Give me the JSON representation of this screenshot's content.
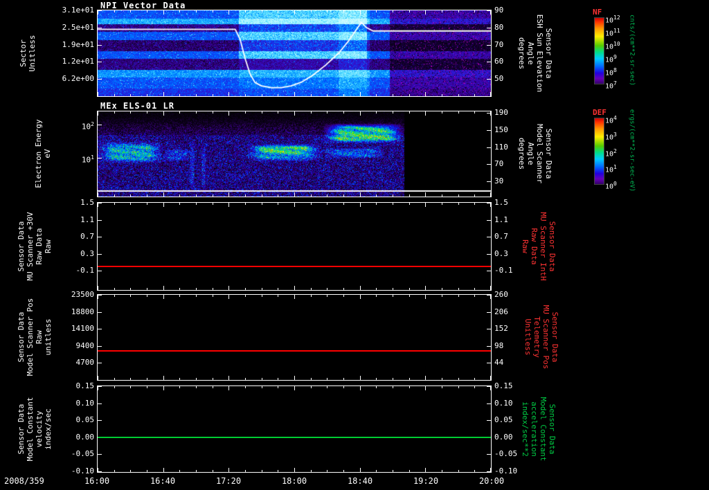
{
  "figure": {
    "date_label": "2008/359",
    "x_tick_labels": [
      "16:00",
      "16:40",
      "17:20",
      "18:00",
      "18:40",
      "19:20",
      "20:00"
    ],
    "colors": {
      "background": "#000000",
      "axis": "#ffffff",
      "red_series": "#ff0000",
      "green_series": "#00cc33",
      "red_label": "#ff3333",
      "green_label": "#00cc44",
      "units_green": "#00bb55"
    }
  },
  "panels": {
    "npi": {
      "title": "NPI Vector Data",
      "left_title": "Sector\nUnitless",
      "left_ticks": [
        "3.1e+01",
        "2.5e+01",
        "1.9e+01",
        "1.2e+01",
        "6.2e+00"
      ],
      "left_tick_fracs": [
        0,
        0.2,
        0.4,
        0.6,
        0.8
      ],
      "right_title": "Sensor Data\nESH Sun Elevation\nAngle\ndegrees",
      "right_ticks": [
        "90",
        "80",
        "70",
        "60",
        "50"
      ],
      "right_tick_fracs": [
        0,
        0.2,
        0.4,
        0.6,
        0.8
      ]
    },
    "els": {
      "title": "MEx ELS-01 LR",
      "left_title": "Electron Energy\neV",
      "left_ticks": [
        "10^2",
        "10^1"
      ],
      "left_tick_fracs": [
        0.156,
        0.547
      ],
      "right_title": "Sensor Data\nModel Scanner\nAngle\ndegrees",
      "right_ticks": [
        "190",
        "150",
        "110",
        "70",
        "30"
      ],
      "right_tick_fracs": [
        0.02,
        0.22,
        0.42,
        0.62,
        0.82
      ]
    },
    "mu30v": {
      "left_title": "Sensor Data\nMU Scanner +30V\nRaw Data\nRaw",
      "left_ticks": [
        "1.5",
        "1.1",
        "0.7",
        "0.3",
        "-0.1"
      ],
      "left_tick_fracs": [
        0,
        0.195,
        0.39,
        0.585,
        0.78
      ],
      "right_title": "Sensor Data\nMU Scanner IntH\nRaw Data\nRaw",
      "right_ticks": [
        "1.5",
        "1.1",
        "0.7",
        "0.3",
        "-0.1"
      ],
      "right_tick_fracs": [
        0,
        0.195,
        0.39,
        0.585,
        0.78
      ]
    },
    "scannerpos": {
      "left_title": "Sensor Data\nModel Scanner Pos\nRaw\nunitless",
      "left_ticks": [
        "23500",
        "18800",
        "14100",
        "9400",
        "4700"
      ],
      "left_tick_fracs": [
        0,
        0.2,
        0.4,
        0.6,
        0.8
      ],
      "right_title": "Sensor Data\nMU Scanner Pos\nTelemetry\nUnitless",
      "right_ticks": [
        "260",
        "206",
        "152",
        "98",
        "44"
      ],
      "right_tick_fracs": [
        0,
        0.2,
        0.4,
        0.6,
        0.8
      ]
    },
    "modelconst": {
      "left_title": "Sensor Data\nModel Constant\nvelocity\nindex/sec",
      "left_ticks": [
        "0.15",
        "0.10",
        "0.05",
        "0.00",
        "-0.05",
        "-0.10"
      ],
      "left_tick_fracs": [
        0,
        0.198,
        0.397,
        0.595,
        0.794,
        0.992
      ],
      "right_title": "Sensor Data\nModel Constant\nacceleration\nindex/sec**2",
      "right_ticks": [
        "0.15",
        "0.10",
        "0.05",
        "0.00",
        "-0.05",
        "-0.10"
      ],
      "right_tick_fracs": [
        0,
        0.198,
        0.397,
        0.595,
        0.794,
        0.992
      ]
    }
  },
  "colorbars": [
    {
      "title": "NF",
      "units": "cnts/(cm**2-sr-sec)",
      "tick_labels": [
        "10^12",
        "10^11",
        "10^10",
        "10^9",
        "10^8",
        "10^7"
      ]
    },
    {
      "title": "DEF",
      "units": "ergs/(cm**2-sr-sec-eV)",
      "tick_labels": [
        "10^4",
        "10^3",
        "10^2",
        "10^1",
        "10^0"
      ]
    }
  ],
  "chart_data": [
    {
      "type": "heatmap",
      "title": "NPI Vector Data",
      "ylabel": "Sector (Unitless)",
      "ylim": [
        0,
        32
      ],
      "yticks": [
        31,
        24.8,
        18.6,
        12.4,
        6.2
      ],
      "x_range": [
        "16:00",
        "20:00"
      ],
      "x_minutes_range": [
        0,
        240
      ],
      "colorbar_title": "NF",
      "colorbar_units": "cnts/(cm**2-sr-sec)",
      "base_level": 0.4,
      "sector_bands": [
        {
          "sectors": [
            27,
            28
          ],
          "level": 0.53
        },
        {
          "sectors": [
            24,
            26
          ],
          "level": 0.18
        },
        {
          "sectors": [
            17,
            20
          ],
          "level": 0.15
        },
        {
          "sectors": [
            10,
            13
          ],
          "level": 0.17
        },
        {
          "sectors": [
            7,
            9
          ],
          "level": 0.5
        },
        {
          "sectors": [
            0,
            2
          ],
          "level": 0.34
        }
      ],
      "bright_region": {
        "minutes": [
          86,
          164
        ],
        "sectors": [
          14,
          32
        ],
        "boost": 0.2
      },
      "bright_column": {
        "minutes": [
          147,
          166
        ],
        "boost": 0.08
      },
      "dark_region": {
        "minutes": [
          178,
          240
        ],
        "scale": 0.55
      },
      "overlay_line": {
        "name": "ESH Sun Elevation Angle",
        "units": "degrees",
        "axis_range": [
          40,
          90
        ],
        "axis_ticks": [
          90,
          80,
          70,
          60,
          50
        ],
        "points": [
          [
            0,
            79
          ],
          [
            84,
            79
          ],
          [
            87,
            73
          ],
          [
            90,
            62
          ],
          [
            93,
            53
          ],
          [
            96,
            48
          ],
          [
            100,
            46
          ],
          [
            106,
            45
          ],
          [
            112,
            45
          ],
          [
            118,
            46
          ],
          [
            124,
            48
          ],
          [
            131,
            52
          ],
          [
            139,
            58
          ],
          [
            147,
            65
          ],
          [
            153,
            72
          ],
          [
            158,
            79
          ],
          [
            161,
            83
          ],
          [
            164,
            80
          ],
          [
            168,
            78
          ],
          [
            240,
            78
          ]
        ]
      }
    },
    {
      "type": "heatmap",
      "title": "MEx ELS-01 LR",
      "ylabel": "Electron Energy (eV)",
      "y_scale": "log",
      "yticks": [
        100,
        10
      ],
      "y_top_exponent": 2.4,
      "y_bottom_exponent": -0.16,
      "x_range": [
        "16:00",
        "20:00"
      ],
      "x_minutes_range": [
        0,
        240
      ],
      "data_end_minute": 187,
      "colorbar_title": "DEF",
      "colorbar_units": "ergs/(cm**2-sr-sec-eV)",
      "features": [
        {
          "minutes": [
            0,
            40
          ],
          "log_e": [
            0.85,
            1.5
          ],
          "boost": 0.38
        },
        {
          "minutes": [
            40,
            56
          ],
          "log_e": [
            0.9,
            1.3
          ],
          "boost": 0.18
        },
        {
          "minutes": [
            90,
            137
          ],
          "log_e": [
            0.9,
            1.45
          ],
          "boost": 0.33
        },
        {
          "minutes": [
            95,
            133
          ],
          "log_e": [
            1.12,
            1.4
          ],
          "boost": 0.2
        },
        {
          "minutes": [
            137,
            187
          ],
          "log_e": [
            1.45,
            2.05
          ],
          "boost": 0.55
        },
        {
          "minutes": [
            137,
            175
          ],
          "log_e": [
            1.0,
            1.32
          ],
          "boost": 0.25
        },
        {
          "minutes": [
            56,
            59
          ],
          "log_e": [
            0.0,
            1.5
          ],
          "boost": 0.15
        },
        {
          "minutes": [
            63,
            66
          ],
          "log_e": [
            0.0,
            1.5
          ],
          "boost": 0.12
        }
      ]
    },
    {
      "type": "line",
      "name": "MU Scanner +30V Raw Data",
      "value": 0.0,
      "ylim": [
        -0.55,
        1.5
      ],
      "yticks": [
        1.5,
        1.1,
        0.7,
        0.3,
        -0.1
      ],
      "color": "#ff0000"
    },
    {
      "type": "line",
      "name": "Model Scanner Pos Raw",
      "value": 8100,
      "ylim": [
        0,
        23500
      ],
      "yticks": [
        23500,
        18800,
        14100,
        9400,
        4700
      ],
      "color": "#ff0000"
    },
    {
      "type": "line",
      "name": "Model Constant velocity",
      "value": 0.0,
      "ylim": [
        -0.1025,
        0.15
      ],
      "yticks": [
        0.15,
        0.1,
        0.05,
        0.0,
        -0.05,
        -0.1
      ],
      "color": "#00cc33"
    }
  ]
}
